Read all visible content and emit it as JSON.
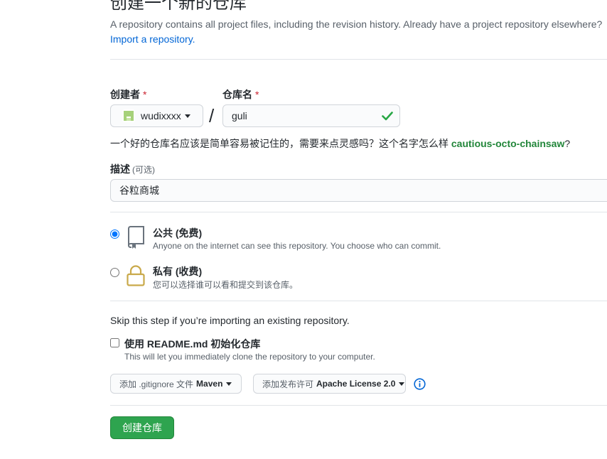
{
  "header": {
    "title": "创建一个新的仓库",
    "subtitle": "A repository contains all project files, including the revision history. Already have a project repository elsewhere?",
    "import_link": "Import a repository."
  },
  "owner": {
    "label": "创建者",
    "required_mark": "*",
    "name": "wudixxxx"
  },
  "repo": {
    "label": "仓库名",
    "required_mark": "*",
    "value": "guli",
    "separator": "/"
  },
  "name_hint": {
    "text": "一个好的仓库名应该是简单容易被记住的，需要来点灵感吗？这个名字怎么样",
    "suggestion": "cautious-octo-chainsaw",
    "suffix": "?"
  },
  "description": {
    "label": "描述",
    "optional": "(可选)",
    "value": "谷粒商城"
  },
  "visibility": {
    "public": {
      "title": "公共 (免费)",
      "note": "Anyone on the internet can see this repository. You choose who can commit.",
      "checked": true
    },
    "private": {
      "title": "私有 (收费)",
      "note": "您可以选择谁可以看和提交到该仓库。",
      "checked": false
    }
  },
  "init": {
    "skip_text": "Skip this step if you’re importing an existing repository.",
    "readme_label": "使用 README.md 初始化仓库",
    "readme_note": "This will let you immediately clone the repository to your computer.",
    "readme_checked": false
  },
  "gitignore": {
    "prefix": "添加 .gitignore 文件",
    "value": "Maven"
  },
  "license": {
    "prefix": "添加发布许可",
    "value": "Apache License 2.0"
  },
  "submit": {
    "label": "创建仓库"
  },
  "colors": {
    "link": "#0366d6",
    "primary_button": "#2ea44f",
    "success_check": "#28a745",
    "suggestion": "#22863a",
    "required": "#cb2431"
  }
}
